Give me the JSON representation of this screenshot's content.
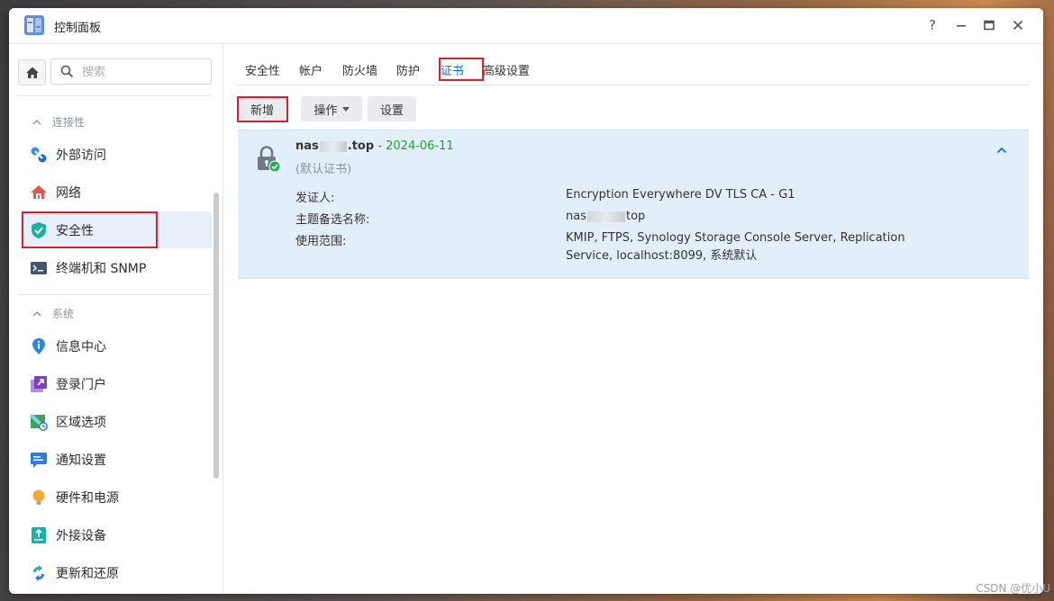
{
  "window": {
    "title": "控制面板",
    "help_glyph": "?",
    "minimize_glyph": "—",
    "maximize_glyph": "□",
    "close_glyph": "✕"
  },
  "sidebar": {
    "search_placeholder": "搜索",
    "groups": [
      {
        "label": "连接性"
      },
      {
        "label": "系统"
      }
    ],
    "items": [
      {
        "label": "外部访问",
        "icon": "external-access-icon"
      },
      {
        "label": "网络",
        "icon": "network-icon"
      },
      {
        "label": "安全性",
        "icon": "security-shield-icon",
        "active": true
      },
      {
        "label": "终端机和 SNMP",
        "icon": "terminal-icon"
      },
      {
        "label": "信息中心",
        "icon": "info-center-icon"
      },
      {
        "label": "登录门户",
        "icon": "login-portal-icon"
      },
      {
        "label": "区域选项",
        "icon": "regional-options-icon"
      },
      {
        "label": "通知设置",
        "icon": "notification-icon"
      },
      {
        "label": "硬件和电源",
        "icon": "hardware-power-icon"
      },
      {
        "label": "外接设备",
        "icon": "external-devices-icon"
      },
      {
        "label": "更新和还原",
        "icon": "update-restore-icon"
      }
    ]
  },
  "tabs": [
    {
      "label": "安全性"
    },
    {
      "label": "帐户"
    },
    {
      "label": "防火墙"
    },
    {
      "label": "防护"
    },
    {
      "label": "证书",
      "active": true
    },
    {
      "label": "高级设置"
    }
  ],
  "toolbar": {
    "add_label": "新增",
    "action_label": "操作",
    "settings_label": "设置"
  },
  "certificate": {
    "name_prefix": "nas",
    "name_suffix": ".top",
    "dash": " - ",
    "expiry": "2024-06-11",
    "default_note": "(默认证书)",
    "issuer_label": "发证人:",
    "issuer_value": "Encryption Everywhere DV TLS CA - G1",
    "san_label": "主题备选名称:",
    "san_prefix": "nas",
    "san_suffix": "top",
    "usage_label": "使用范围:",
    "usage_value": "KMIP, FTPS, Synology Storage Console Server, Replication Service, localhost:8099, 系统默认"
  },
  "colors": {
    "accent": "#0b70d6",
    "expiry_green": "#20a02a",
    "highlight_red": "#d9202b",
    "selected_row": "#e3eefb"
  },
  "watermark": "CSDN @优小U"
}
